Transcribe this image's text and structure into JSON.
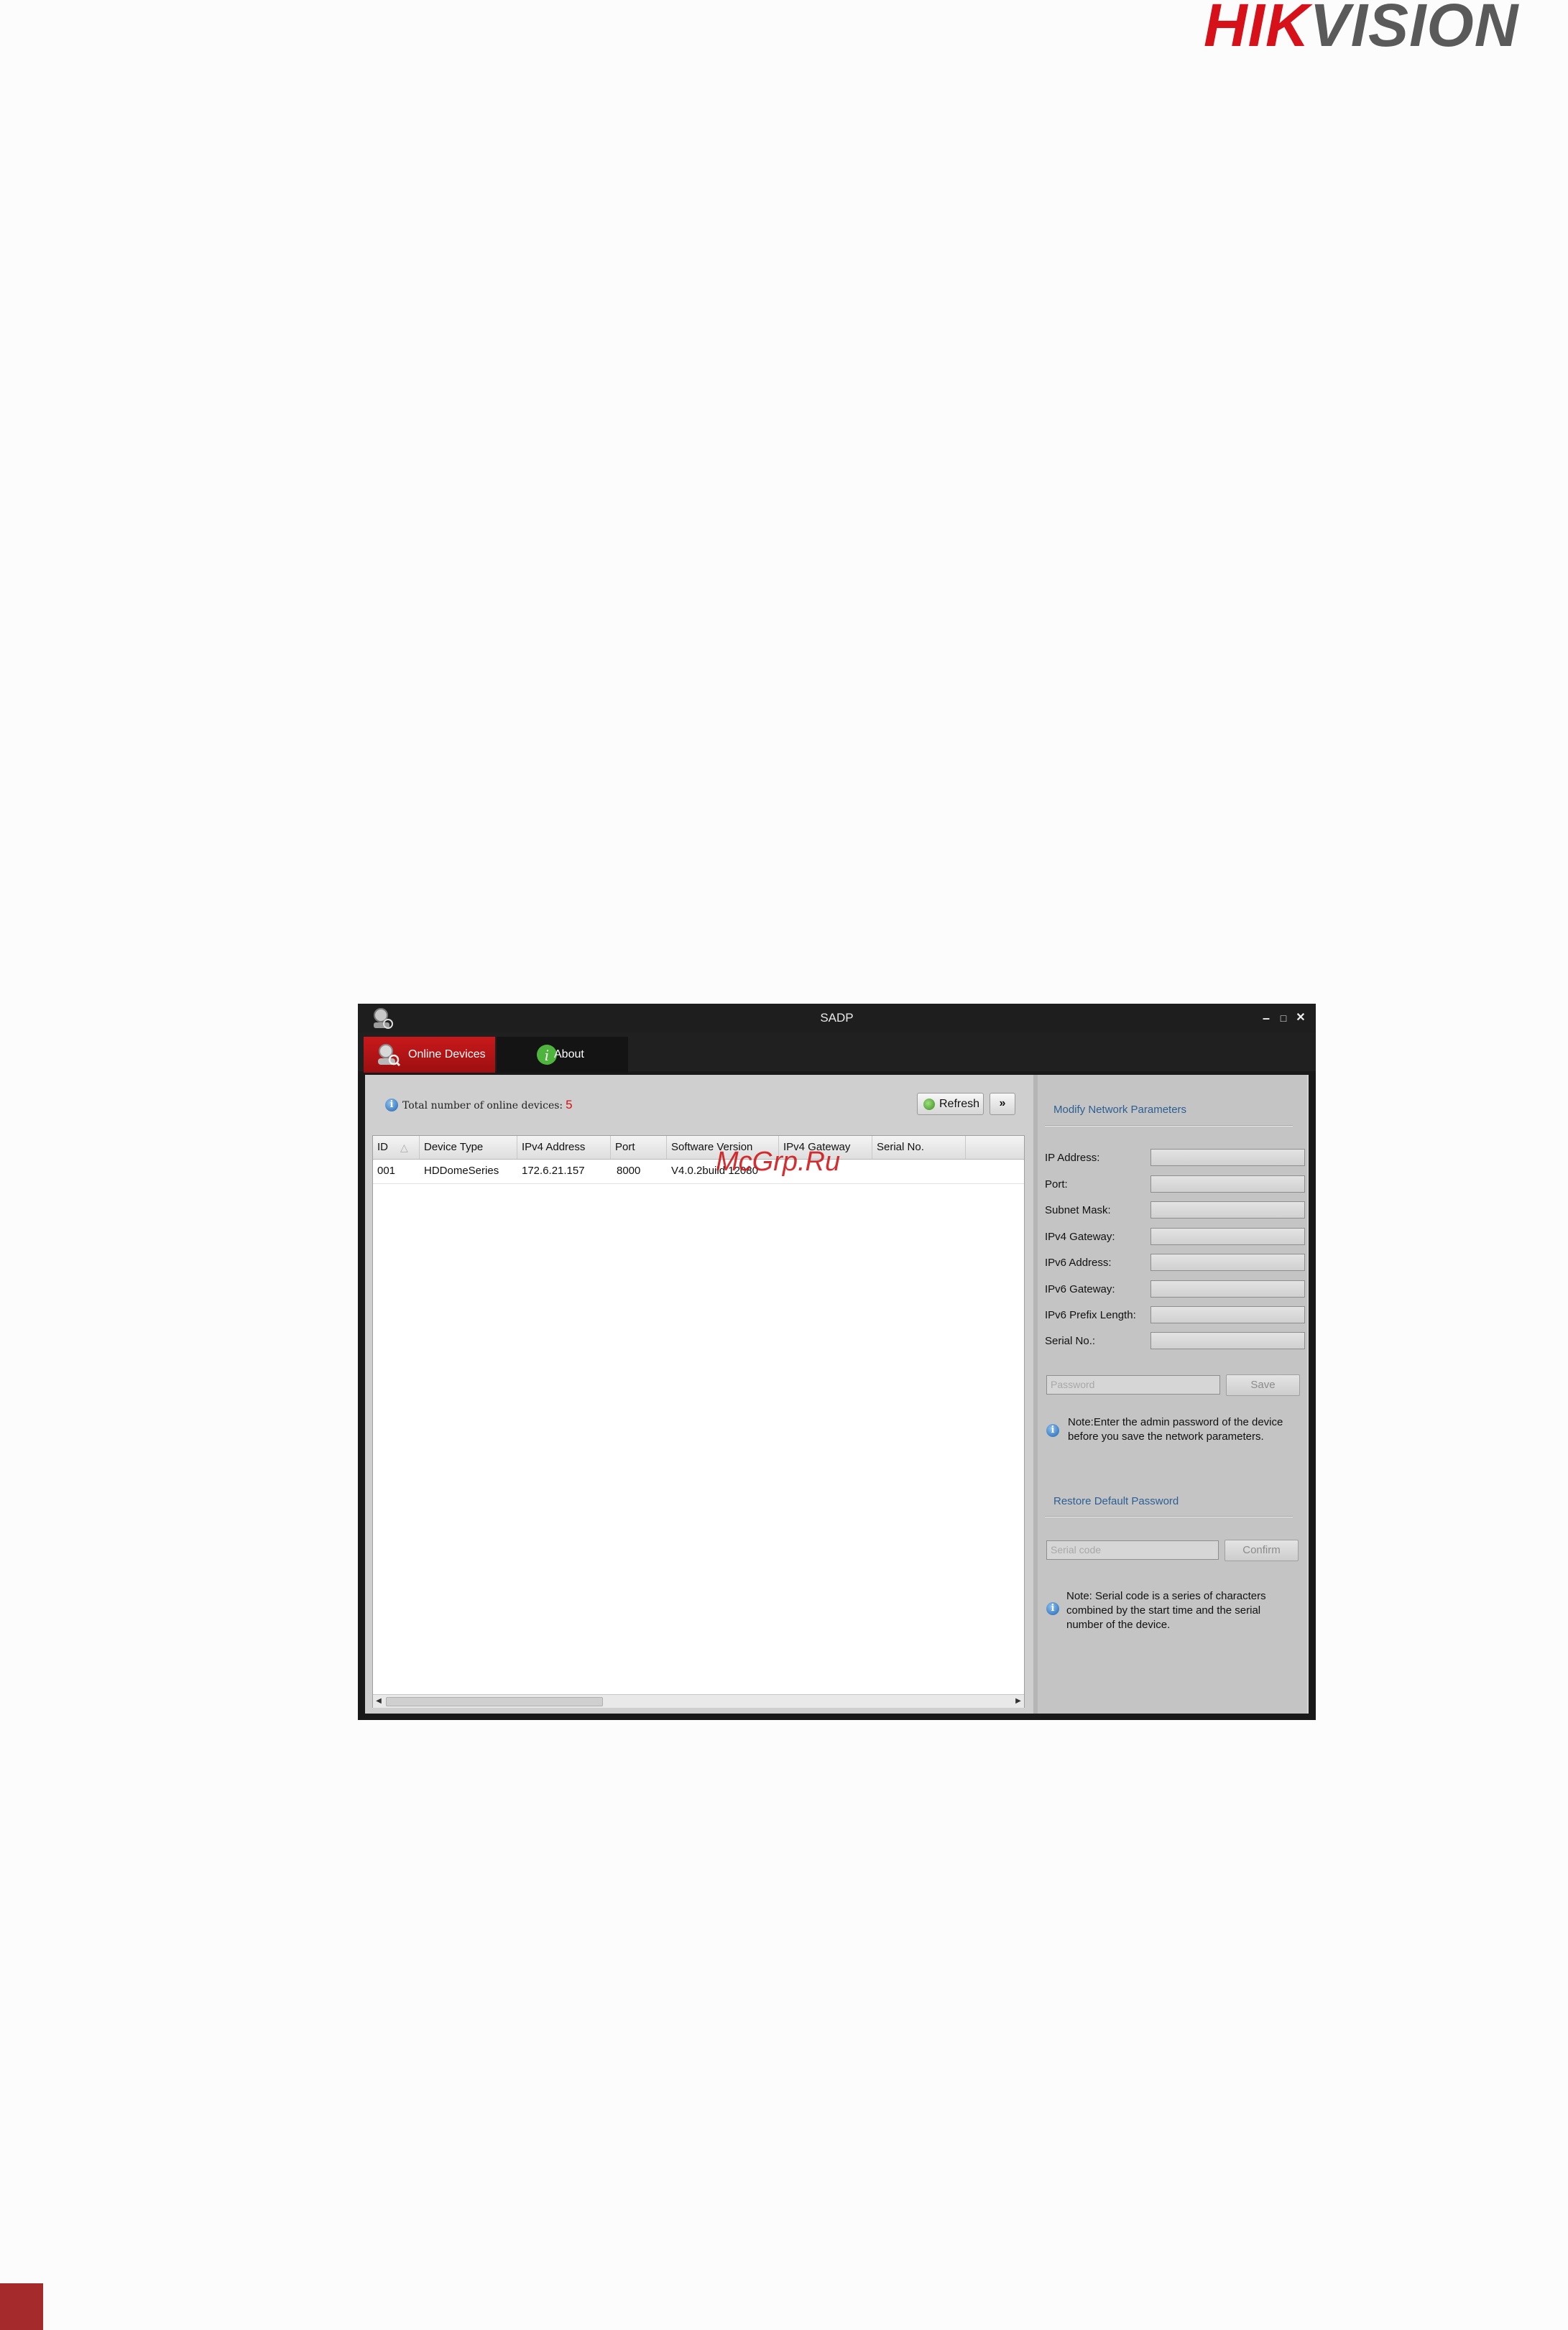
{
  "brand": {
    "part1": "HIK",
    "part2": "VISION",
    "accent": "#d6111a"
  },
  "window": {
    "title": "SADP",
    "controls": {
      "minimize": "–",
      "maximize": "□",
      "close": "✕"
    },
    "tabs": [
      {
        "label": "Online Devices",
        "icon": "user-magnifier-icon"
      },
      {
        "label": "About",
        "icon": "info-icon"
      }
    ]
  },
  "devices": {
    "total_label": "Total number of online devices:",
    "total_count": "5",
    "refresh_label": "Refresh",
    "more_label": "»",
    "columns": [
      "ID",
      "Device Type",
      "IPv4 Address",
      "Port",
      "Software Version",
      "IPv4 Gateway",
      "Serial No."
    ],
    "rows": [
      {
        "id": "001",
        "type": "HDDomeSeries",
        "ipv4": "172.6.21.157",
        "port": "8000",
        "software": "V4.0.2build 12080",
        "gateway": "",
        "serial": ""
      }
    ]
  },
  "modify": {
    "title": "Modify Network Parameters",
    "fields": [
      {
        "label": "IP Address:",
        "value": ""
      },
      {
        "label": "Port:",
        "value": ""
      },
      {
        "label": "Subnet Mask:",
        "value": ""
      },
      {
        "label": "IPv4 Gateway:",
        "value": ""
      },
      {
        "label": "IPv6 Address:",
        "value": ""
      },
      {
        "label": "IPv6 Gateway:",
        "value": ""
      },
      {
        "label": "IPv6 Prefix Length:",
        "value": ""
      },
      {
        "label": "Serial No.:",
        "value": ""
      }
    ],
    "password_placeholder": "Password",
    "save_label": "Save",
    "note": "Note:Enter the admin password of the device before you save the network parameters."
  },
  "restore": {
    "title": "Restore Default Password",
    "serial_placeholder": "Serial code",
    "confirm_label": "Confirm",
    "note": "Note: Serial code is a series of characters combined by the start time and the serial number of the device."
  },
  "watermark": "McGrp.Ru"
}
